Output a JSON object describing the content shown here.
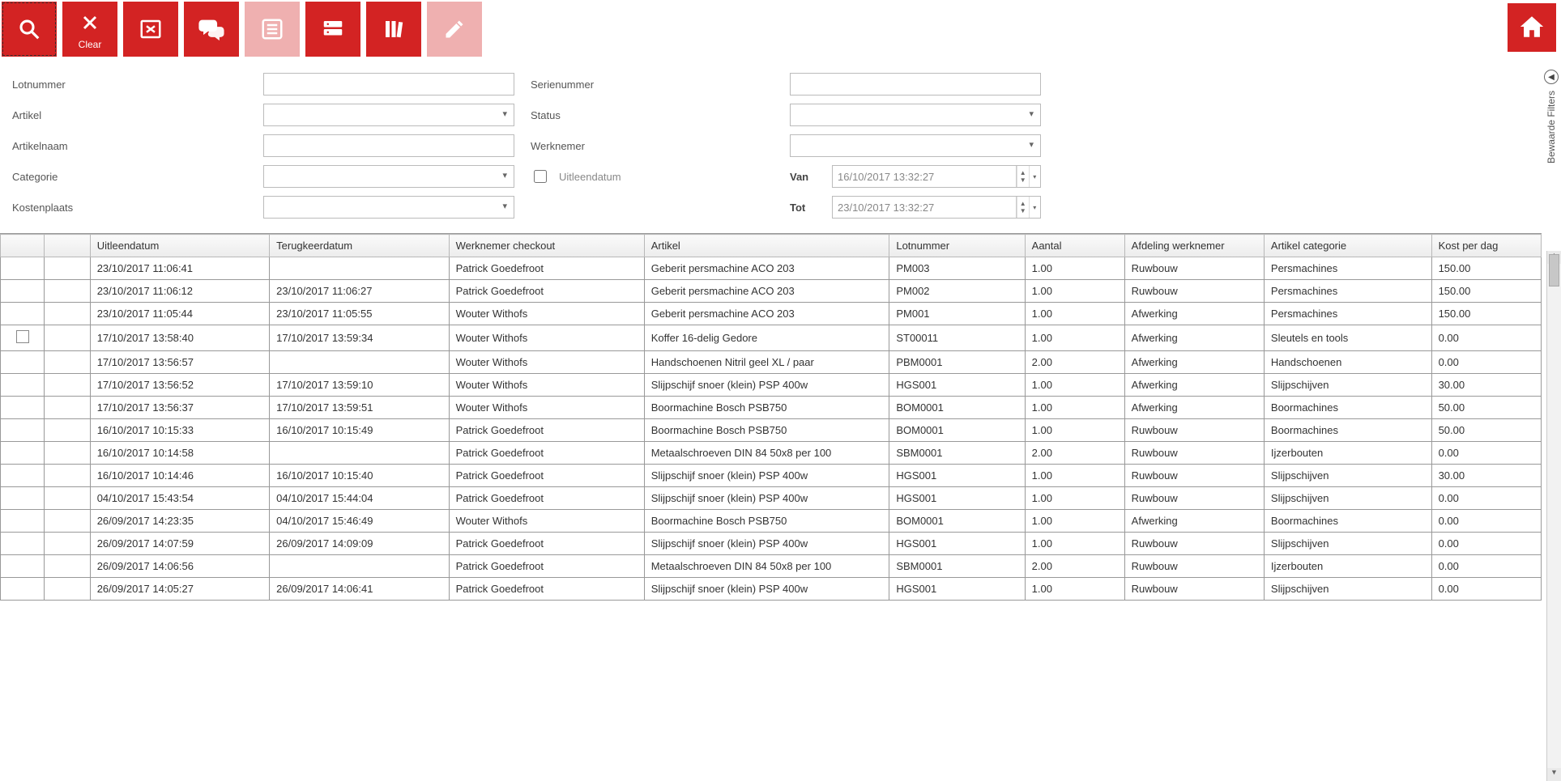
{
  "toolbar": {
    "search": "",
    "clear": "Clear",
    "excel": "",
    "chat": "",
    "list": "",
    "server": "",
    "books": "",
    "edit": ""
  },
  "filters": {
    "labels": {
      "lotnummer": "Lotnummer",
      "serienummer": "Serienummer",
      "artikel": "Artikel",
      "status": "Status",
      "artikelnaam": "Artikelnaam",
      "werknemer": "Werknemer",
      "categorie": "Categorie",
      "uitleendatum": "Uitleendatum",
      "kostenplaats": "Kostenplaats",
      "van": "Van",
      "tot": "Tot"
    },
    "values": {
      "lotnummer": "",
      "serienummer": "",
      "artikel": "",
      "status": "",
      "artikelnaam": "",
      "werknemer": "",
      "categorie": "",
      "kostenplaats": "",
      "uitleendatum_checked": false,
      "van": "16/10/2017 13:32:27",
      "tot": "23/10/2017 13:32:27"
    }
  },
  "sidebar": {
    "label": "Bewaarde Filters"
  },
  "grid": {
    "headers": {
      "uitleendatum": "Uitleendatum",
      "terugkeerdatum": "Terugkeerdatum",
      "werknemer_checkout": "Werknemer checkout",
      "artikel": "Artikel",
      "lotnummer": "Lotnummer",
      "aantal": "Aantal",
      "afdeling_werknemer": "Afdeling werknemer",
      "artikel_categorie": "Artikel categorie",
      "kost_per_dag": "Kost per dag"
    },
    "rows": [
      {
        "sel": false,
        "uit": "23/10/2017 11:06:41",
        "ter": "",
        "emp": "Patrick Goedefroot",
        "art": "Geberit persmachine ACO 203",
        "lot": "PM003",
        "qty": "1.00",
        "dept": "Ruwbouw",
        "cat": "Persmachines",
        "cost": "150.00"
      },
      {
        "sel": false,
        "uit": "23/10/2017 11:06:12",
        "ter": "23/10/2017 11:06:27",
        "emp": "Patrick Goedefroot",
        "art": "Geberit persmachine ACO 203",
        "lot": "PM002",
        "qty": "1.00",
        "dept": "Ruwbouw",
        "cat": "Persmachines",
        "cost": "150.00"
      },
      {
        "sel": false,
        "uit": "23/10/2017 11:05:44",
        "ter": "23/10/2017 11:05:55",
        "emp": "Wouter Withofs",
        "art": "Geberit persmachine ACO 203",
        "lot": "PM001",
        "qty": "1.00",
        "dept": "Afwerking",
        "cat": "Persmachines",
        "cost": "150.00"
      },
      {
        "sel": true,
        "uit": "17/10/2017 13:58:40",
        "ter": "17/10/2017 13:59:34",
        "emp": "Wouter Withofs",
        "art": "Koffer 16-delig Gedore",
        "lot": "ST00011",
        "qty": "1.00",
        "dept": "Afwerking",
        "cat": "Sleutels en tools",
        "cost": "0.00"
      },
      {
        "sel": false,
        "uit": "17/10/2017 13:56:57",
        "ter": "",
        "emp": "Wouter Withofs",
        "art": "Handschoenen Nitril geel XL / paar",
        "lot": "PBM0001",
        "qty": "2.00",
        "dept": "Afwerking",
        "cat": "Handschoenen",
        "cost": "0.00"
      },
      {
        "sel": false,
        "uit": "17/10/2017 13:56:52",
        "ter": "17/10/2017 13:59:10",
        "emp": "Wouter Withofs",
        "art": "Slijpschijf snoer (klein) PSP 400w",
        "lot": "HGS001",
        "qty": "1.00",
        "dept": "Afwerking",
        "cat": "Slijpschijven",
        "cost": "30.00"
      },
      {
        "sel": false,
        "uit": "17/10/2017 13:56:37",
        "ter": "17/10/2017 13:59:51",
        "emp": "Wouter Withofs",
        "art": "Boormachine Bosch PSB750",
        "lot": "BOM0001",
        "qty": "1.00",
        "dept": "Afwerking",
        "cat": "Boormachines",
        "cost": "50.00"
      },
      {
        "sel": false,
        "uit": "16/10/2017 10:15:33",
        "ter": "16/10/2017 10:15:49",
        "emp": "Patrick Goedefroot",
        "art": "Boormachine Bosch PSB750",
        "lot": "BOM0001",
        "qty": "1.00",
        "dept": "Ruwbouw",
        "cat": "Boormachines",
        "cost": "50.00"
      },
      {
        "sel": false,
        "uit": "16/10/2017 10:14:58",
        "ter": "",
        "emp": "Patrick Goedefroot",
        "art": "Metaalschroeven DIN 84 50x8 per 100",
        "lot": "SBM0001",
        "qty": "2.00",
        "dept": "Ruwbouw",
        "cat": "Ijzerbouten",
        "cost": "0.00"
      },
      {
        "sel": false,
        "uit": "16/10/2017 10:14:46",
        "ter": "16/10/2017 10:15:40",
        "emp": "Patrick Goedefroot",
        "art": "Slijpschijf snoer (klein) PSP 400w",
        "lot": "HGS001",
        "qty": "1.00",
        "dept": "Ruwbouw",
        "cat": "Slijpschijven",
        "cost": "30.00"
      },
      {
        "sel": false,
        "uit": "04/10/2017 15:43:54",
        "ter": "04/10/2017 15:44:04",
        "emp": "Patrick Goedefroot",
        "art": "Slijpschijf snoer (klein) PSP 400w",
        "lot": "HGS001",
        "qty": "1.00",
        "dept": "Ruwbouw",
        "cat": "Slijpschijven",
        "cost": "0.00"
      },
      {
        "sel": false,
        "uit": "26/09/2017 14:23:35",
        "ter": "04/10/2017 15:46:49",
        "emp": "Wouter Withofs",
        "art": "Boormachine Bosch PSB750",
        "lot": "BOM0001",
        "qty": "1.00",
        "dept": "Afwerking",
        "cat": "Boormachines",
        "cost": "0.00"
      },
      {
        "sel": false,
        "uit": "26/09/2017 14:07:59",
        "ter": "26/09/2017 14:09:09",
        "emp": "Patrick Goedefroot",
        "art": "Slijpschijf snoer (klein) PSP 400w",
        "lot": "HGS001",
        "qty": "1.00",
        "dept": "Ruwbouw",
        "cat": "Slijpschijven",
        "cost": "0.00"
      },
      {
        "sel": false,
        "uit": "26/09/2017 14:06:56",
        "ter": "",
        "emp": "Patrick Goedefroot",
        "art": "Metaalschroeven DIN 84 50x8 per 100",
        "lot": "SBM0001",
        "qty": "2.00",
        "dept": "Ruwbouw",
        "cat": "Ijzerbouten",
        "cost": "0.00"
      },
      {
        "sel": false,
        "uit": "26/09/2017 14:05:27",
        "ter": "26/09/2017 14:06:41",
        "emp": "Patrick Goedefroot",
        "art": "Slijpschijf snoer (klein) PSP 400w",
        "lot": "HGS001",
        "qty": "1.00",
        "dept": "Ruwbouw",
        "cat": "Slijpschijven",
        "cost": "0.00"
      }
    ]
  }
}
